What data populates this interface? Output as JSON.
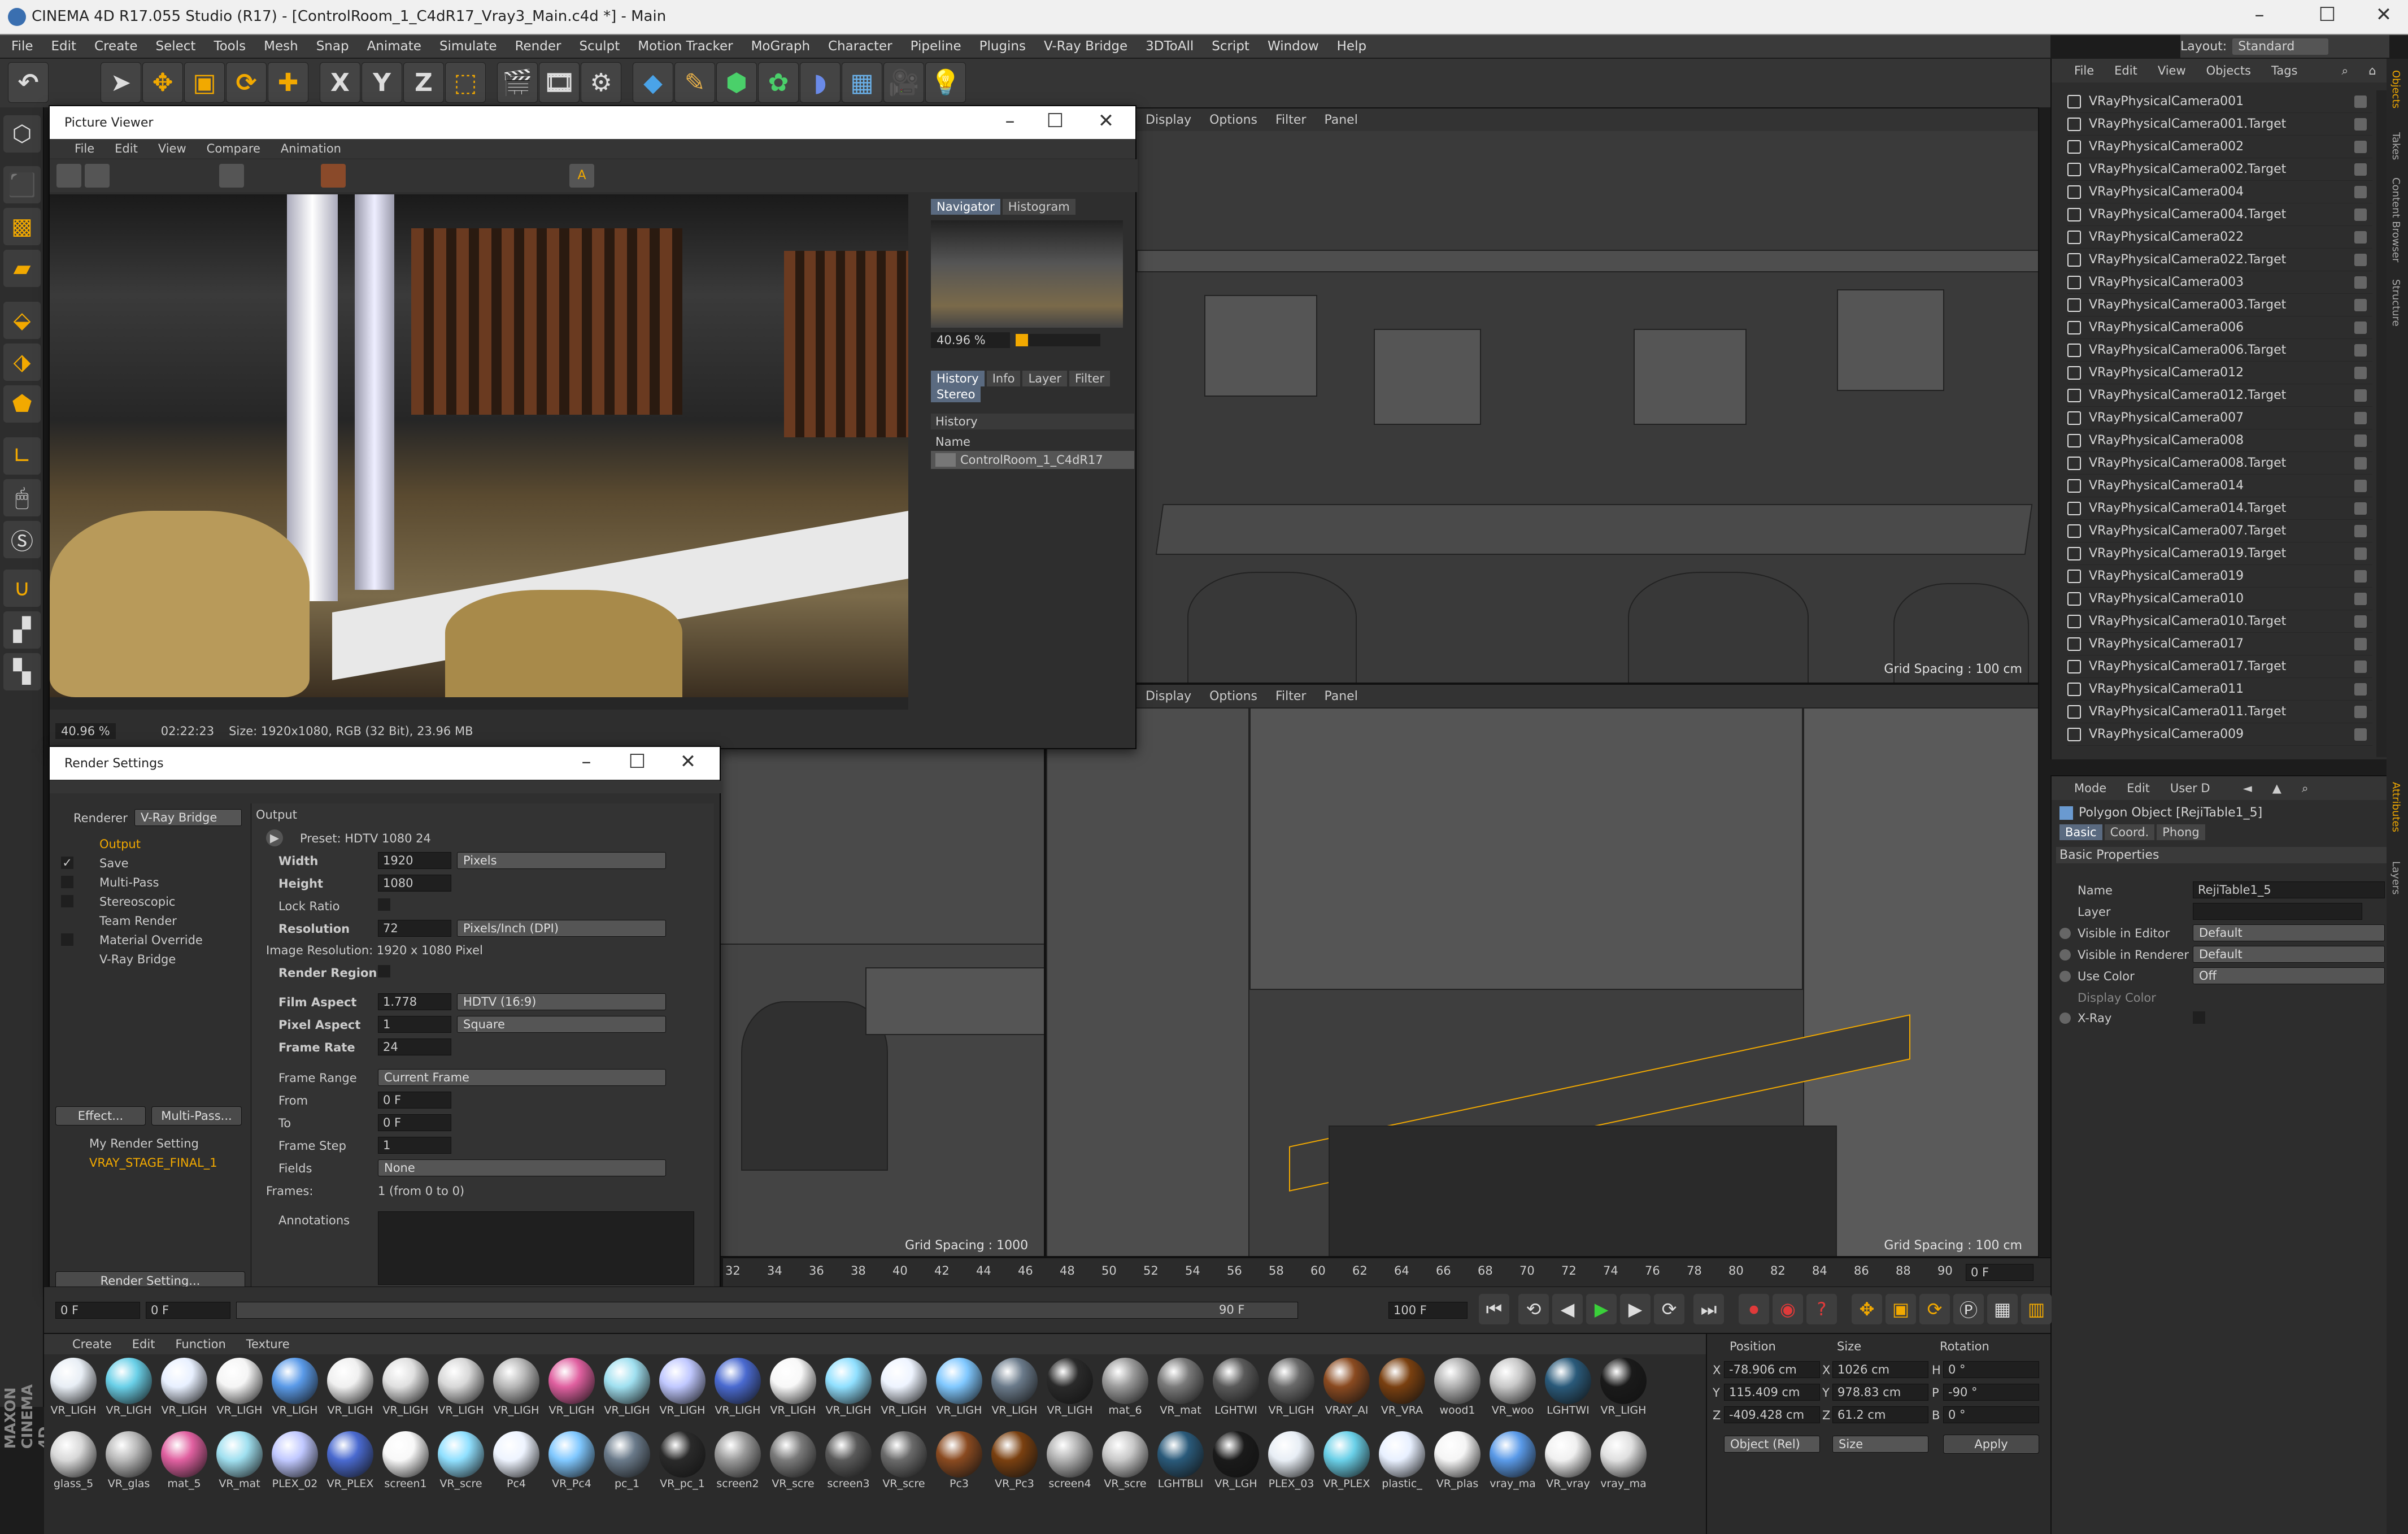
{
  "window": {
    "title": "CINEMA 4D R17.055 Studio (R17) - [ControlRoom_1_C4dR17_Vray3_Main.c4d *] - Main",
    "layout_label": "Layout:",
    "layout_value": "Standard"
  },
  "menu": [
    "File",
    "Edit",
    "Create",
    "Select",
    "Tools",
    "Mesh",
    "Snap",
    "Animate",
    "Simulate",
    "Render",
    "Sculpt",
    "Motion Tracker",
    "MoGraph",
    "Character",
    "Pipeline",
    "Plugins",
    "V-Ray Bridge",
    "3DToAll",
    "Script",
    "Window",
    "Help"
  ],
  "toolbar_axes": [
    "X",
    "Y",
    "Z"
  ],
  "viewports": {
    "menu": [
      "Display",
      "Options",
      "Filter",
      "Panel"
    ],
    "top_right_grid": "Grid Spacing : 100 cm",
    "bottom_left_grid": "Grid Spacing : 1000 cm",
    "bottom_right_grid": "Grid Spacing : 100 cm"
  },
  "picture_viewer": {
    "title": "Picture Viewer",
    "menu": [
      "File",
      "Edit",
      "View",
      "Compare",
      "Animation"
    ],
    "tabs_top": [
      "Navigator",
      "Histogram"
    ],
    "zoom": "40.96 %",
    "tabs_mid": [
      "History",
      "Info",
      "Layer",
      "Filter"
    ],
    "tab_stereo": "Stereo",
    "history_label": "History",
    "name_label": "Name",
    "history_item": "ControlRoom_1_C4dR17",
    "status_zoom": "40.96 %",
    "status_time": "02:22:23",
    "status_size": "Size: 1920x1080, RGB (32 Bit), 23.96 MB"
  },
  "render_settings": {
    "title": "Render Settings",
    "renderer_label": "Renderer",
    "renderer_value": "V-Ray Bridge",
    "tree": [
      "Output",
      "Save",
      "Multi-Pass",
      "Stereoscopic",
      "Team Render",
      "Material Override",
      "V-Ray Bridge"
    ],
    "effect_btn": "Effect...",
    "multipass_btn": "Multi-Pass...",
    "settings": [
      "My Render Setting",
      "VRAY_STAGE_FINAL_1"
    ],
    "render_setting_btn": "Render Setting...",
    "output_title": "Output",
    "preset": "Preset: HDTV 1080 24",
    "width_label": "Width",
    "width_value": "1920",
    "width_unit": "Pixels",
    "height_label": "Height",
    "height_value": "1080",
    "lock_label": "Lock Ratio",
    "res_label": "Resolution",
    "res_value": "72",
    "res_unit": "Pixels/Inch (DPI)",
    "image_res": "Image Resolution: 1920 x 1080 Pixel",
    "region_label": "Render Region",
    "film_label": "Film Aspect",
    "film_value": "1.778",
    "film_preset": "HDTV (16:9)",
    "pixel_label": "Pixel Aspect",
    "pixel_value": "1",
    "pixel_preset": "Square",
    "rate_label": "Frame Rate",
    "rate_value": "24",
    "range_label": "Frame Range",
    "range_value": "Current Frame",
    "from_label": "From",
    "from_value": "0 F",
    "to_label": "To",
    "to_value": "0 F",
    "step_label": "Frame Step",
    "step_value": "1",
    "fields_label": "Fields",
    "fields_value": "None",
    "frames_label": "Frames:",
    "frames_value": "1 (from 0 to 0)",
    "annotations_label": "Annotations"
  },
  "objects": {
    "menu": [
      "File",
      "Edit",
      "View",
      "Objects",
      "Tags"
    ],
    "items": [
      "VRayPhysicalCamera001",
      "VRayPhysicalCamera001.Target",
      "VRayPhysicalCamera002",
      "VRayPhysicalCamera002.Target",
      "VRayPhysicalCamera004",
      "VRayPhysicalCamera004.Target",
      "VRayPhysicalCamera022",
      "VRayPhysicalCamera022.Target",
      "VRayPhysicalCamera003",
      "VRayPhysicalCamera003.Target",
      "VRayPhysicalCamera006",
      "VRayPhysicalCamera006.Target",
      "VRayPhysicalCamera012",
      "VRayPhysicalCamera012.Target",
      "VRayPhysicalCamera007",
      "VRayPhysicalCamera008",
      "VRayPhysicalCamera008.Target",
      "VRayPhysicalCamera014",
      "VRayPhysicalCamera014.Target",
      "VRayPhysicalCamera007.Target",
      "VRayPhysicalCamera019.Target",
      "VRayPhysicalCamera019",
      "VRayPhysicalCamera010",
      "VRayPhysicalCamera010.Target",
      "VRayPhysicalCamera017",
      "VRayPhysicalCamera017.Target",
      "VRayPhysicalCamera011",
      "VRayPhysicalCamera011.Target",
      "VRayPhysicalCamera009"
    ]
  },
  "side_tabs": [
    "Objects",
    "Takes",
    "Content Browser",
    "Structure",
    "Attributes",
    "Layers"
  ],
  "attributes": {
    "menu": [
      "Mode",
      "Edit",
      "User D"
    ],
    "object": "Polygon Object [RejiTable1_5]",
    "tabs": [
      "Basic",
      "Coord.",
      "Phong"
    ],
    "section": "Basic Properties",
    "name_label": "Name",
    "name_value": "RejiTable1_5",
    "layer_label": "Layer",
    "vis_editor_label": "Visible in Editor",
    "vis_editor_value": "Default",
    "vis_render_label": "Visible in Renderer",
    "vis_render_value": "Default",
    "use_color_label": "Use Color",
    "use_color_value": "Off",
    "display_color_label": "Display Color",
    "xray_label": "X-Ray"
  },
  "timeline": {
    "ticks": [
      "32",
      "34",
      "36",
      "38",
      "40",
      "42",
      "44",
      "46",
      "48",
      "50",
      "52",
      "54",
      "56",
      "58",
      "60",
      "62",
      "64",
      "66",
      "68",
      "70",
      "72",
      "74",
      "76",
      "78",
      "80",
      "82",
      "84",
      "86",
      "88",
      "90"
    ],
    "current": "0 F",
    "start": "0 F",
    "start2": "0 F",
    "end": "90 F",
    "end2": "100 F"
  },
  "materials": {
    "menu": [
      "Create",
      "Edit",
      "Function",
      "Texture"
    ],
    "row1": [
      "VR_LIGH",
      "VR_LIGH",
      "VR_LIGH",
      "VR_LIGH",
      "VR_LIGH",
      "VR_LIGH",
      "VR_LIGH",
      "VR_LIGH",
      "VR_LIGH",
      "VR_LIGH",
      "VR_LIGH",
      "VR_LIGH",
      "VR_LIGH",
      "VR_LIGH",
      "VR_LIGH",
      "VR_LIGH",
      "VR_LIGH",
      "VR_LIGH",
      "VR_LIGH",
      "mat_6",
      "VR_mat",
      "LGHTWI",
      "VR_LIGH",
      "VRAY_AI",
      "VR_VRA",
      "wood1",
      "VR_woo",
      "LGHTWI",
      "VR_LIGH"
    ],
    "row2": [
      "glass_5",
      "VR_glas",
      "mat_5",
      "VR_mat",
      "PLEX_02",
      "VR_PLEX",
      "screen1",
      "VR_scre",
      "Pc4",
      "VR_Pc4",
      "pc_1",
      "VR_pc_1",
      "screen2",
      "VR_scre",
      "screen3",
      "VR_scre",
      "Pc3",
      "VR_Pc3",
      "screen4",
      "VR_scre",
      "LGHTBLI",
      "VR_LGH",
      "PLEX_03",
      "VR_PLEX",
      "plastic_",
      "VR_plas",
      "vray_ma",
      "VR_vray",
      "vray_ma"
    ]
  },
  "coords": {
    "position_label": "Position",
    "size_label": "Size",
    "rotation_label": "Rotation",
    "px": "-78.906 cm",
    "py": "115.409 cm",
    "pz": "-409.428 cm",
    "sx": "1026 cm",
    "sy": "978.83 cm",
    "sz": "61.2 cm",
    "rh": "0 °",
    "rp": "-90 °",
    "rb": "0 °",
    "mode_value": "Object (Rel)",
    "size_mode": "Size",
    "apply_btn": "Apply"
  },
  "brand": "MAXON CINEMA 4D"
}
